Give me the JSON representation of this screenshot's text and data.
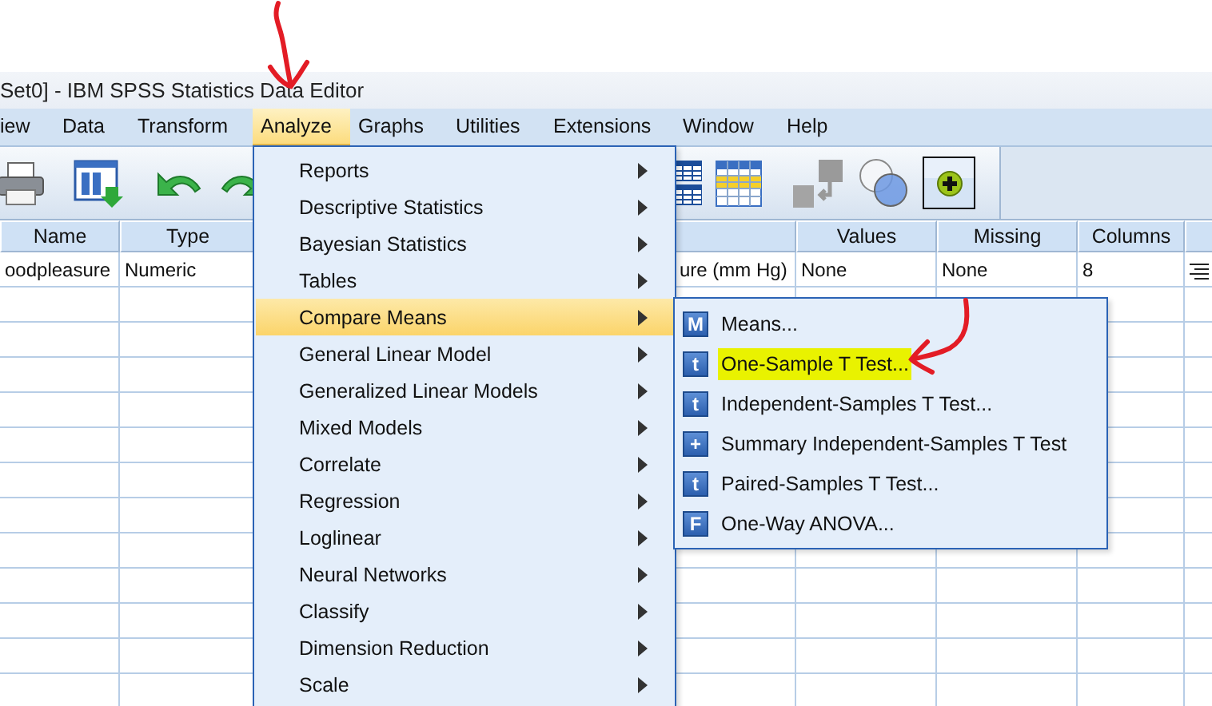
{
  "window": {
    "title": "Set0] - IBM SPSS Statistics Data Editor"
  },
  "menubar": [
    {
      "label": "iew",
      "selected": false
    },
    {
      "label": "Data",
      "selected": false
    },
    {
      "label": "Transform",
      "selected": false
    },
    {
      "label": "Analyze",
      "selected": true
    },
    {
      "label": "Graphs",
      "selected": false
    },
    {
      "label": "Utilities",
      "selected": false
    },
    {
      "label": "Extensions",
      "selected": false
    },
    {
      "label": "Window",
      "selected": false
    },
    {
      "label": "Help",
      "selected": false
    }
  ],
  "grid": {
    "columns": [
      {
        "label": "Name"
      },
      {
        "label": "Type"
      },
      {},
      {},
      {
        "label": "Values"
      },
      {
        "label": "Missing"
      },
      {
        "label": "Columns"
      },
      {}
    ],
    "rows": [
      {
        "cells": [
          "oodpleasure",
          "Numeric",
          null,
          "ure (mm Hg)",
          "None",
          "None",
          "8",
          null
        ]
      }
    ]
  },
  "analyze_menu": {
    "items": [
      {
        "label": "Reports",
        "selected": false,
        "submenu": true
      },
      {
        "label": "Descriptive Statistics",
        "selected": false,
        "submenu": true
      },
      {
        "label": "Bayesian Statistics",
        "selected": false,
        "submenu": true
      },
      {
        "label": "Tables",
        "selected": false,
        "submenu": true
      },
      {
        "label": "Compare Means",
        "selected": true,
        "submenu": true
      },
      {
        "label": "General Linear Model",
        "selected": false,
        "submenu": true
      },
      {
        "label": "Generalized Linear Models",
        "selected": false,
        "submenu": true
      },
      {
        "label": "Mixed Models",
        "selected": false,
        "submenu": true
      },
      {
        "label": "Correlate",
        "selected": false,
        "submenu": true
      },
      {
        "label": "Regression",
        "selected": false,
        "submenu": true
      },
      {
        "label": "Loglinear",
        "selected": false,
        "submenu": true
      },
      {
        "label": "Neural Networks",
        "selected": false,
        "submenu": true
      },
      {
        "label": "Classify",
        "selected": false,
        "submenu": true
      },
      {
        "label": "Dimension Reduction",
        "selected": false,
        "submenu": true
      },
      {
        "label": "Scale",
        "selected": false,
        "submenu": true
      }
    ]
  },
  "compare_means_menu": {
    "items": [
      {
        "label": "Means...",
        "icon": "M",
        "highlighted": false
      },
      {
        "label": "One-Sample T Test...",
        "icon": "t",
        "highlighted": true
      },
      {
        "label": "Independent-Samples T Test...",
        "icon": "t",
        "highlighted": false
      },
      {
        "label": "Summary Independent-Samples T Test",
        "icon": "+",
        "highlighted": false
      },
      {
        "label": "Paired-Samples T Test...",
        "icon": "t",
        "highlighted": false
      },
      {
        "label": "One-Way ANOVA...",
        "icon": "F",
        "highlighted": false
      }
    ]
  }
}
